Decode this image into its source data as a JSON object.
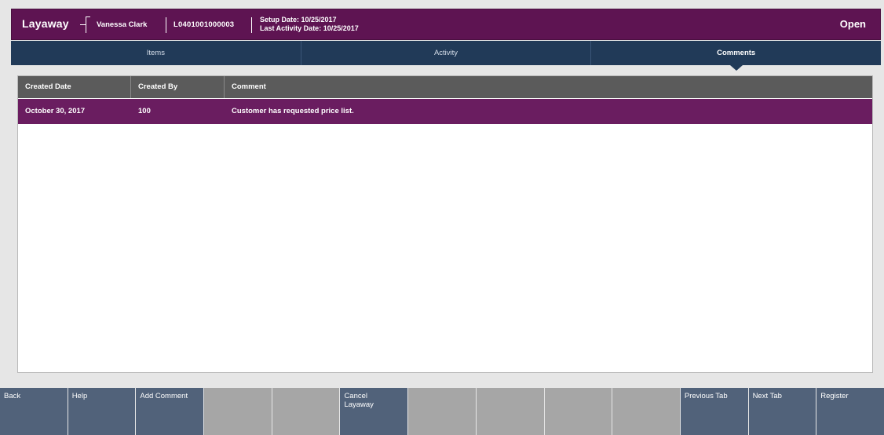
{
  "header": {
    "title": "Layaway",
    "customer_name": "Vanessa Clark",
    "layaway_id": "L0401001000003",
    "setup_date": "Setup Date:  10/25/2017",
    "last_activity_date": "Last Activity Date:  10/25/2017",
    "status": "Open"
  },
  "tabs": [
    {
      "label": "Items",
      "active": false
    },
    {
      "label": "Activity",
      "active": false
    },
    {
      "label": "Comments",
      "active": true
    }
  ],
  "table": {
    "columns": [
      "Created Date",
      "Created By",
      "Comment"
    ],
    "rows": [
      {
        "created_date": "October 30, 2017",
        "created_by": "100",
        "comment": "Customer has requested price list.",
        "selected": true
      }
    ]
  },
  "buttons": [
    {
      "label": "Back",
      "enabled": true
    },
    {
      "label": "Help",
      "enabled": true
    },
    {
      "label": "Add Comment",
      "enabled": true
    },
    {
      "label": "",
      "enabled": false
    },
    {
      "label": "",
      "enabled": false
    },
    {
      "label": "Cancel\nLayaway",
      "enabled": true
    },
    {
      "label": "",
      "enabled": false
    },
    {
      "label": "",
      "enabled": false
    },
    {
      "label": "",
      "enabled": false
    },
    {
      "label": "",
      "enabled": false
    },
    {
      "label": "Previous Tab",
      "enabled": true
    },
    {
      "label": "Next Tab",
      "enabled": true
    },
    {
      "label": "Register",
      "enabled": true
    }
  ],
  "colors": {
    "header_bg": "#5e1452",
    "tab_bg": "#213a58",
    "selected_row": "#6a1d60",
    "table_header": "#5b5b5b",
    "button_enabled": "#51627a",
    "button_disabled": "#a6a6a6"
  },
  "icons": {
    "header_bracket": "bracket-icon",
    "active_tab_indicator": "caret-down-icon"
  }
}
